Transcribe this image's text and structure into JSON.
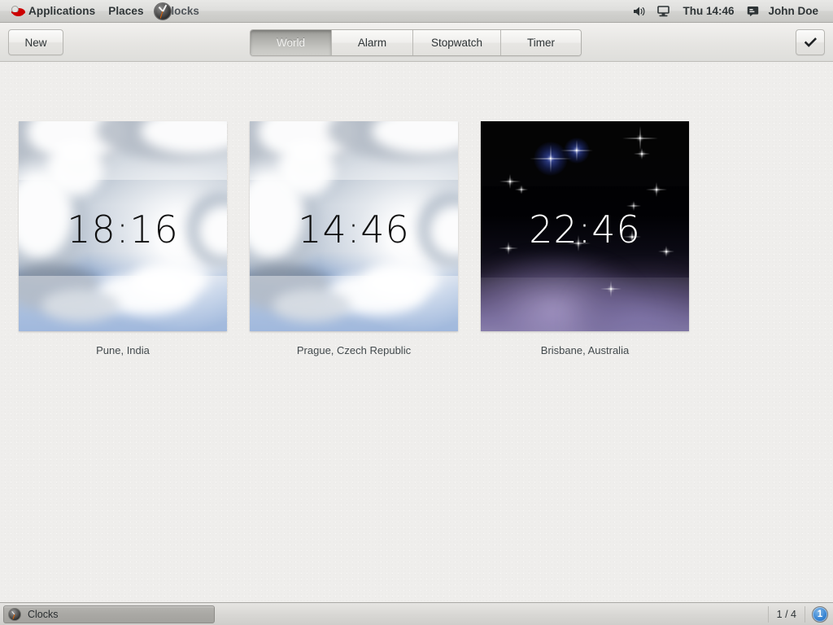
{
  "top_panel": {
    "logo_icon": "redhat-logo-icon",
    "applications_label": "Applications",
    "places_label": "Places",
    "app_icon": "clocks-app-icon",
    "app_label": "Clocks",
    "volume_icon": "volume-icon",
    "display_icon": "display-icon",
    "clock": "Thu 14:46",
    "message_icon": "message-icon",
    "user_name": "John Doe"
  },
  "toolbar": {
    "new_label": "New",
    "done_icon": "checkmark-icon",
    "tabs": [
      {
        "label": "World",
        "active": true
      },
      {
        "label": "Alarm",
        "active": false
      },
      {
        "label": "Stopwatch",
        "active": false
      },
      {
        "label": "Timer",
        "active": false
      }
    ]
  },
  "world_clocks": [
    {
      "time": "18:16",
      "location": "Pune, India",
      "period": "day"
    },
    {
      "time": "14:46",
      "location": "Prague, Czech Republic",
      "period": "day"
    },
    {
      "time": "22:46",
      "location": "Brisbane, Australia",
      "period": "night"
    }
  ],
  "taskbar": {
    "window_icon": "clocks-app-icon",
    "window_label": "Clocks",
    "workspace": "1 / 4",
    "notification_count": "1"
  },
  "colors": {
    "panel_text": "#2e3436",
    "accent_blue": "#3a86d4",
    "redhat_red": "#cc0000",
    "background": "#efeeec"
  }
}
